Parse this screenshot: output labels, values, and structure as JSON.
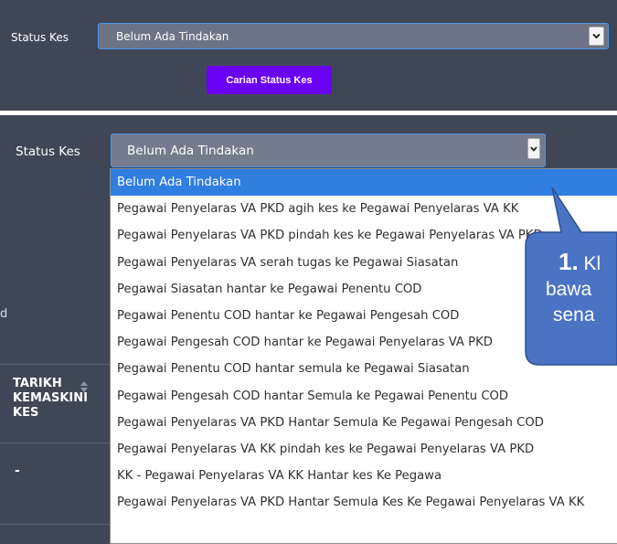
{
  "top": {
    "status_label": "Status Kes",
    "selected_value": "Belum Ada Tindakan",
    "search_button": "Carian Status Kes"
  },
  "bottom": {
    "status_label": "Status Kes",
    "selected_value": "Belum Ada Tindakan",
    "side_fragment": "d",
    "table_header": [
      "TARIKH",
      "KEMASKINI",
      "KES"
    ],
    "row_value": "-"
  },
  "dropdown_options": [
    "Belum Ada Tindakan",
    "Pegawai Penyelaras VA PKD agih kes ke Pegawai Penyelaras VA KK",
    "Pegawai Penyelaras VA PKD pindah kes ke Pegawai Penyelaras VA PKD",
    "Pegawai Penyelaras VA serah tugas ke Pegawai Siasatan",
    "Pegawai Siasatan hantar ke Pegawai Penentu COD",
    "Pegawai Penentu COD hantar ke Pegawai Pengesah COD",
    "Pegawai Pengesah COD hantar ke Pegawai Penyelaras VA PKD",
    "Pegawai Penentu COD hantar semula ke Pegawai Siasatan",
    "Pegawai Pengesah COD hantar Semula ke Pegawai Penentu COD",
    "Pegawai Penyelaras VA PKD Hantar Semula Ke Pegawai Pengesah COD",
    "Pegawai Penyelaras VA KK pindah kes ke Pegawai Penyelaras VA PKD",
    "KK - Pegawai Penyelaras VA KK Hantar kes Ke Pegawa",
    "Pegawai Penyelaras VA PKD Hantar Semula Kes Ke Pegawai Penyelaras VA KK"
  ],
  "callout": {
    "number": "1.",
    "line1": "Kl",
    "line2": "bawa",
    "line3": "sena"
  },
  "colors": {
    "panel": "#3f4757",
    "select_bg": "#6b7385",
    "select_border": "#4e96ea",
    "button": "#6a00f4",
    "highlight": "#2f7ee0",
    "callout_fill": "#4a73c4",
    "callout_stroke": "#2f4f8f"
  }
}
